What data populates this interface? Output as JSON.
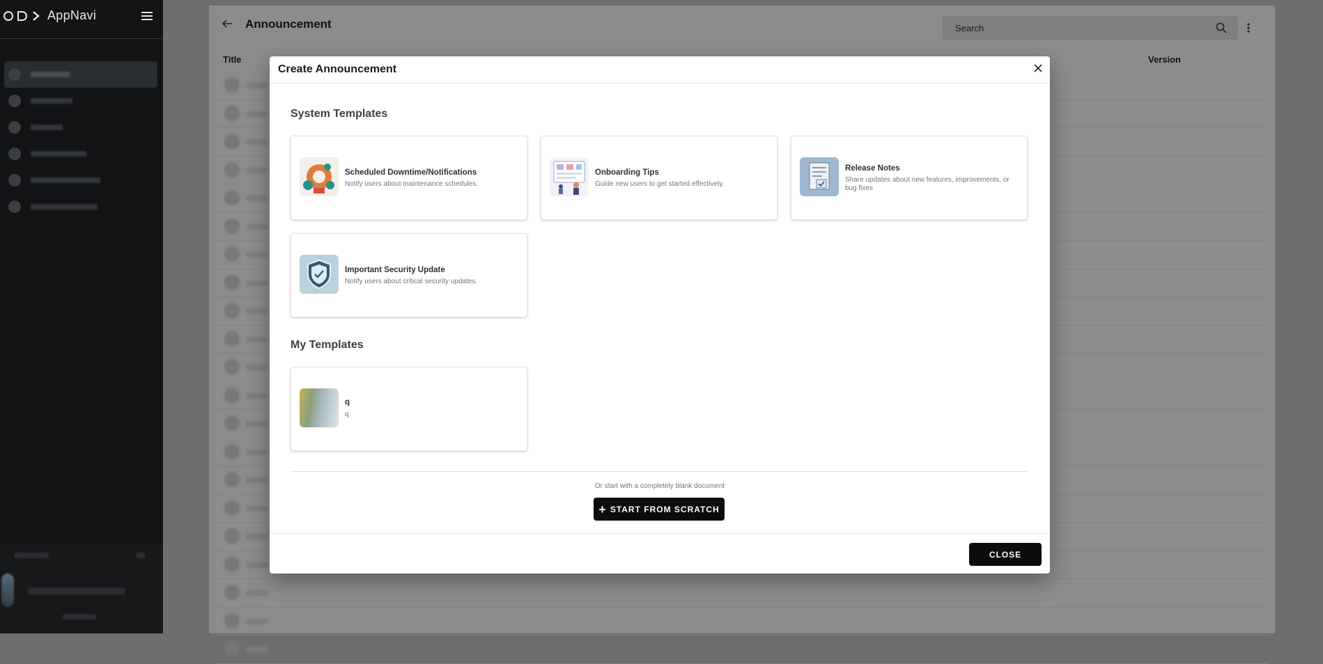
{
  "app": {
    "name": "AppNavi"
  },
  "page": {
    "title": "Announcement",
    "search_placeholder": "Search",
    "columns": {
      "title": "Title",
      "version": "Version"
    }
  },
  "modal": {
    "title": "Create Announcement",
    "system_section": "System Templates",
    "my_section": "My Templates",
    "system_templates": [
      {
        "title": "Scheduled Downtime/Notifications",
        "description": "Notify users about maintenance schedules."
      },
      {
        "title": "Onboarding Tips",
        "description": "Guide new users to get started effectively."
      },
      {
        "title": "Release Notes",
        "description": "Share updates about new features, improvements, or bug fixes"
      },
      {
        "title": "Important Security Update",
        "description": "Notify users about critical security updates."
      }
    ],
    "my_templates": [
      {
        "title": "q",
        "description": "q"
      }
    ],
    "blank_text": "Or start with a completely blank document",
    "scratch_label": "START FROM SCRATCH",
    "close_label": "CLOSE"
  },
  "icons": [
    "menu-icon",
    "back-arrow-icon",
    "search-icon",
    "more-vert-icon",
    "close-icon",
    "plus-icon"
  ],
  "colors": {
    "sidebar_bg": "#111315",
    "button_bg": "#0c0c0c",
    "overlay": "#6e6e6e"
  }
}
